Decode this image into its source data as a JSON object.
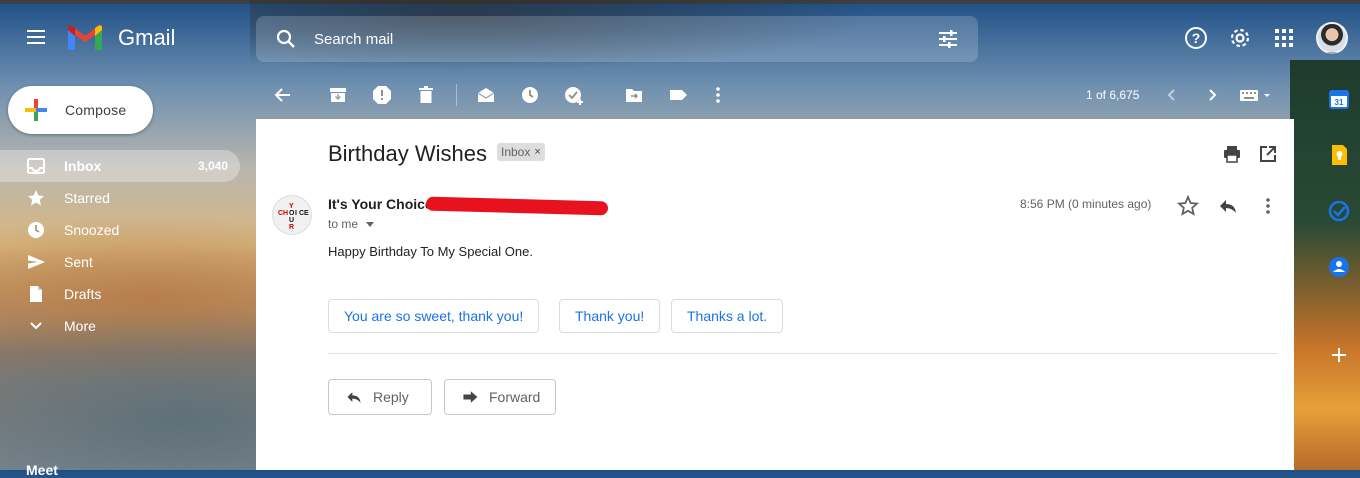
{
  "app": {
    "name": "Gmail"
  },
  "search": {
    "placeholder": "Search mail"
  },
  "compose": {
    "label": "Compose"
  },
  "sidebar": {
    "items": [
      {
        "label": "Inbox",
        "count": "3,040"
      },
      {
        "label": "Starred"
      },
      {
        "label": "Snoozed"
      },
      {
        "label": "Sent"
      },
      {
        "label": "Drafts"
      },
      {
        "label": "More"
      }
    ],
    "meet_label": "Meet"
  },
  "toolbar": {
    "pager": "1 of 6,675"
  },
  "email": {
    "subject": "Birthday Wishes",
    "label_chip": "Inbox",
    "label_chip_close": "×",
    "sender": "It's Your Choice",
    "recipient": "to me",
    "timestamp": "8:56 PM (0 minutes ago)",
    "body": "Happy Birthday To My Special One.",
    "smart_replies": [
      "You are so sweet, thank you!",
      "Thank you!",
      "Thanks a lot."
    ],
    "reply_label": "Reply",
    "forward_label": "Forward"
  },
  "colors": {
    "accent": "#1a73e8",
    "redaction": "#e8121e",
    "panel": "#ffffff"
  },
  "icons": [
    "menu-icon",
    "gmail-logo",
    "search-icon",
    "tune-icon",
    "help-icon",
    "settings-icon",
    "apps-icon",
    "back-icon",
    "archive-icon",
    "report-spam-icon",
    "delete-icon",
    "mark-unread-icon",
    "snooze-icon",
    "add-task-icon",
    "move-to-icon",
    "label-icon",
    "more-vert-icon",
    "keyboard-icon",
    "print-icon",
    "open-new-window-icon",
    "star-icon",
    "reply-icon",
    "forward-icon",
    "calendar-icon",
    "keep-icon",
    "tasks-icon",
    "contacts-icon",
    "add-icon"
  ]
}
